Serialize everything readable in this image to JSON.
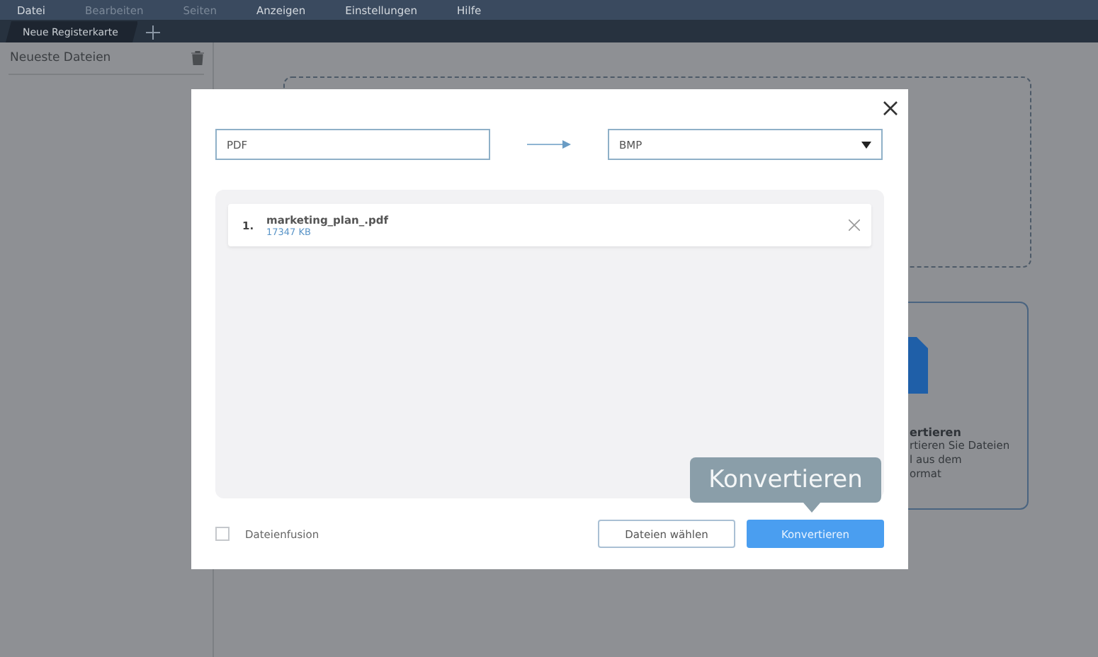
{
  "menu": [
    {
      "label": "Datei",
      "disabled": false
    },
    {
      "label": "Bearbeiten",
      "disabled": true
    },
    {
      "label": "Seiten",
      "disabled": true
    },
    {
      "label": "Anzeigen",
      "disabled": false
    },
    {
      "label": "Einstellungen",
      "disabled": false
    },
    {
      "label": "Hilfe",
      "disabled": false
    }
  ],
  "tabs": [
    {
      "label": "Neue Registerkarte",
      "selected": true
    }
  ],
  "sidebar": {
    "title": "Neueste Dateien"
  },
  "background_card": {
    "title": "ertieren",
    "lines": [
      "rtieren Sie Dateien",
      "l aus dem",
      "ormat"
    ]
  },
  "dialog": {
    "source_format": "PDF",
    "target_format": "BMP",
    "files": [
      {
        "number": "1.",
        "name": "marketing_plan_.pdf",
        "size": "17347 KB"
      }
    ],
    "merge": {
      "label": "Dateienfusion",
      "checked": false
    },
    "choose_button": "Dateien wählen",
    "convert_button": "Konvertieren",
    "tooltip": "Konvertieren"
  }
}
